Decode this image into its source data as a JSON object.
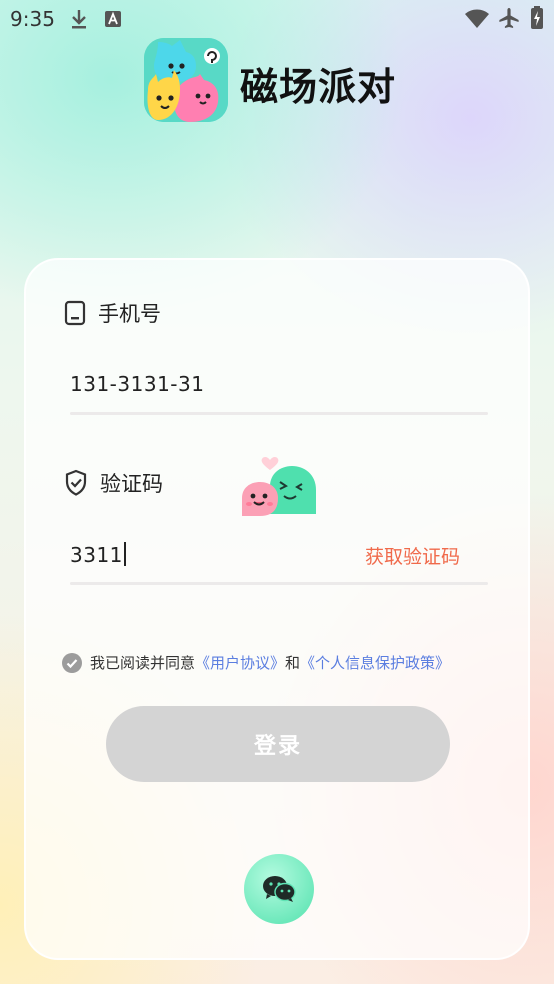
{
  "status_bar": {
    "time": "9:35"
  },
  "app": {
    "name": "磁场派对"
  },
  "form": {
    "phone": {
      "label": "手机号",
      "value": "131-3131-31"
    },
    "code": {
      "label": "验证码",
      "value": "3311",
      "get_code_label": "获取验证码"
    }
  },
  "agreement": {
    "prefix": "我已阅读并同意",
    "user_agreement": "《用户协议》",
    "and": "和",
    "privacy_policy": "《个人信息保护政策》"
  },
  "login_button": {
    "label": "登录"
  },
  "colors": {
    "accent": "#f06a4b",
    "link": "#5b7ee0",
    "disabled_button": "#d4d4d4"
  }
}
